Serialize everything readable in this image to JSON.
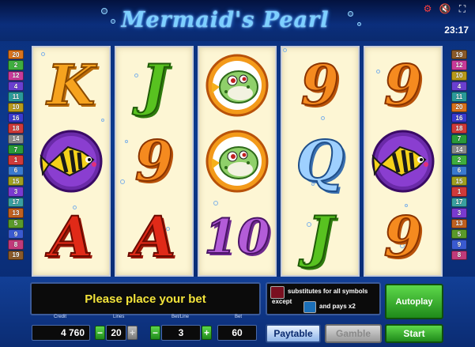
{
  "header": {
    "title": "Mermaid's Pearl",
    "clock": "23:17",
    "icons": [
      "settings-off-icon",
      "sound-muted-icon",
      "fullscreen-icon"
    ]
  },
  "lines": {
    "left": [
      "20",
      "2",
      "12",
      "4",
      "11",
      "10",
      "16",
      "18",
      "14",
      "7",
      "1",
      "6",
      "15",
      "3",
      "17",
      "13",
      "5",
      "9",
      "8",
      "19"
    ],
    "left_colors": [
      "#d9731c",
      "#3fae3f",
      "#c93a9a",
      "#6a3fd0",
      "#2a9a9a",
      "#b89a1a",
      "#3a3ad0",
      "#d03a3a",
      "#8a8a8a",
      "#2a9a3a",
      "#d03a3a",
      "#3a7ad0",
      "#a0a020",
      "#7a3ad0",
      "#3aa0a0",
      "#c06020",
      "#5a9a2a",
      "#3a5ad0",
      "#c03a7a",
      "#8a5a2a"
    ],
    "right": [
      "19",
      "12",
      "10",
      "4",
      "11",
      "20",
      "16",
      "18",
      "7",
      "14",
      "2",
      "6",
      "15",
      "1",
      "17",
      "3",
      "13",
      "5",
      "9",
      "8"
    ],
    "right_colors": [
      "#8a5a2a",
      "#c93a9a",
      "#b89a1a",
      "#6a3fd0",
      "#2a9a9a",
      "#d9731c",
      "#3a3ad0",
      "#d03a3a",
      "#2a9a3a",
      "#8a8a8a",
      "#3fae3f",
      "#3a7ad0",
      "#a0a020",
      "#d03a3a",
      "#3aa0a0",
      "#7a3ad0",
      "#c06020",
      "#5a9a2a",
      "#3a5ad0",
      "#c03a7a"
    ]
  },
  "reels": [
    [
      "K",
      "angelfish",
      "A"
    ],
    [
      "J",
      "9",
      "A"
    ],
    [
      "pufferfish",
      "pufferfish",
      "10"
    ],
    [
      "9",
      "Q",
      "J"
    ],
    [
      "9",
      "angelfish",
      "9"
    ]
  ],
  "message": "Please place your bet",
  "info": {
    "line1": "substitutes for all symbols",
    "line2": "except",
    "line3": "and pays x2"
  },
  "fields": {
    "credit_label": "Credit",
    "credit": "4 760",
    "lines_label": "Lines",
    "lines": "20",
    "betline_label": "Bet/Line",
    "betline": "3",
    "bet_label": "Bet",
    "bet": "60",
    "minus": "−",
    "plus": "+"
  },
  "buttons": {
    "autoplay": "Autoplay",
    "start": "Start",
    "paytable": "Paytable",
    "gamble": "Gamble"
  }
}
